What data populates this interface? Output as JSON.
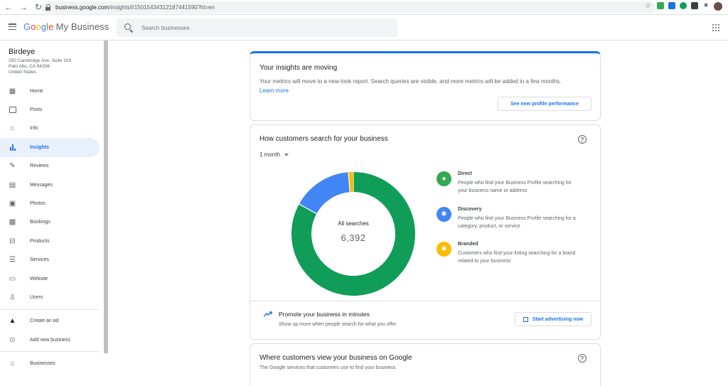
{
  "browser": {
    "url_host": "business.google.com",
    "url_path": "/insights/l/15015434312187441590?hl=en"
  },
  "header": {
    "brand_google": [
      "G",
      "o",
      "o",
      "g",
      "l",
      "e"
    ],
    "brand_suffix": "My Business",
    "search_placeholder": "Search businesses"
  },
  "sidebar": {
    "business_name": "Birdeye",
    "address_line1": "250 Cambridge Ave, Suite 103",
    "address_line2": "Palo Alto, CA 94306",
    "address_line3": "United States",
    "items": [
      {
        "label": "Home"
      },
      {
        "label": "Posts"
      },
      {
        "label": "Info"
      },
      {
        "label": "Insights"
      },
      {
        "label": "Reviews"
      },
      {
        "label": "Messages"
      },
      {
        "label": "Photos"
      },
      {
        "label": "Bookings"
      },
      {
        "label": "Products"
      },
      {
        "label": "Services"
      },
      {
        "label": "Website"
      },
      {
        "label": "Users"
      }
    ],
    "extra_items": [
      {
        "label": "Create an ad"
      },
      {
        "label": "Add new business"
      }
    ],
    "bottom_items": [
      {
        "label": "Businesses"
      }
    ]
  },
  "insights_card": {
    "title": "Your insights are moving",
    "description": "Your metrics will move to a new-look report. Search queries are visible, and more metrics will be added in a few months.",
    "learn_more": "Learn more",
    "button": "See new profile performance"
  },
  "search_card": {
    "title": "How customers search for your business",
    "period": "1 month",
    "center_label": "All searches",
    "center_value": "6,392",
    "legend": [
      {
        "title": "Direct",
        "desc": "People who find your Business Profile searching for your business name or address",
        "color": "#34a853"
      },
      {
        "title": "Discovery",
        "desc": "People who find your Business Profile searching for a category, product, or service",
        "color": "#4285f4"
      },
      {
        "title": "Branded",
        "desc": "Customers who find your listing searching for a brand related to your business",
        "color": "#fbbc04"
      }
    ],
    "promo_title": "Promote your business in minutes",
    "promo_subtitle": "Show up more when people search for what you offer",
    "promo_button": "Start advertising now"
  },
  "view_card": {
    "title": "Where customers view your business on Google",
    "subtitle": "The Google services that customers use to find your business"
  },
  "chart_data": {
    "type": "pie",
    "categories": [
      "Direct",
      "Discovery",
      "Branded"
    ],
    "values": [
      83,
      15.7,
      1.3
    ],
    "colors": [
      "#0f9d58",
      "#4285f4",
      "#fbbc04"
    ],
    "total_label": "All searches",
    "total": 6392
  }
}
